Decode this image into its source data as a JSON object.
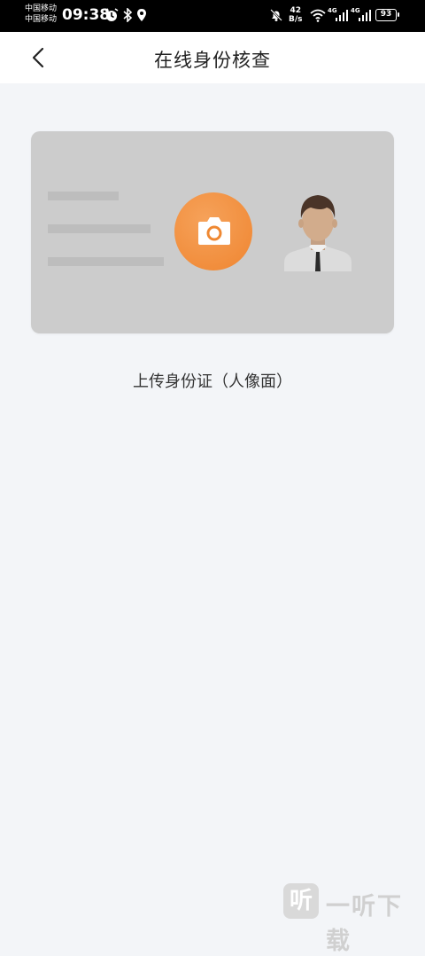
{
  "status_bar": {
    "carrier_1": "中国移动",
    "carrier_2": "中国移动",
    "time": "09:38",
    "net_speed_value": "42",
    "net_speed_unit": "B/s",
    "signal_1_label": "4G",
    "signal_2_label": "4G",
    "battery": "93",
    "icons": [
      "alarm-icon",
      "bluetooth-icon",
      "location-icon",
      "mute-bell-icon",
      "wifi-icon",
      "signal-icon",
      "signal-icon",
      "battery-icon"
    ]
  },
  "header": {
    "title": "在线身份核查",
    "back_icon": "chevron-left-icon"
  },
  "id_card": {
    "camera_icon": "camera-icon",
    "avatar_icon": "person-avatar-icon",
    "upload_label": "上传身份证（人像面）",
    "colors": {
      "card": "#cccccc",
      "camera_button": "#f08a36",
      "bars": "#bdbdbd"
    }
  },
  "watermark": {
    "logo_char": "听",
    "text": "一听下载"
  }
}
